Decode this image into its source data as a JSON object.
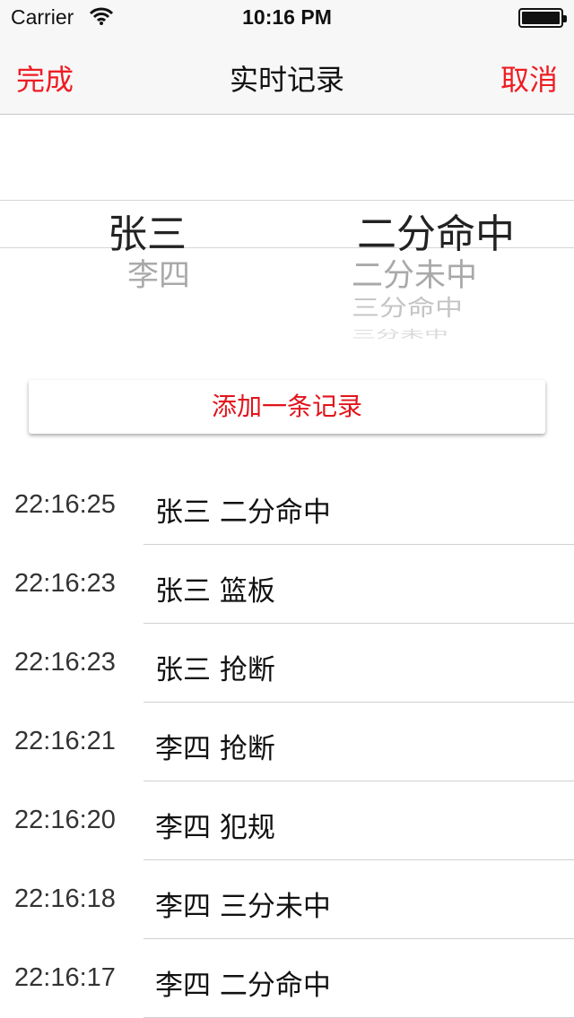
{
  "status_bar": {
    "carrier": "Carrier",
    "time": "10:16 PM"
  },
  "nav": {
    "left_label": "完成",
    "title": "实时记录",
    "right_label": "取消"
  },
  "picker": {
    "players": [
      "张三",
      "李四"
    ],
    "selected_player": "张三",
    "actions": [
      "二分命中",
      "二分未中",
      "三分命中",
      "三分未中"
    ],
    "selected_action": "二分命中"
  },
  "add_button": {
    "label": "添加一条记录"
  },
  "records": [
    {
      "time": "22:16:25",
      "text": "张三 二分命中"
    },
    {
      "time": "22:16:23",
      "text": "张三 篮板"
    },
    {
      "time": "22:16:23",
      "text": "张三 抢断"
    },
    {
      "time": "22:16:21",
      "text": "李四 抢断"
    },
    {
      "time": "22:16:20",
      "text": "李四 犯规"
    },
    {
      "time": "22:16:18",
      "text": "李四 三分未中"
    },
    {
      "time": "22:16:17",
      "text": "李四 二分命中"
    }
  ],
  "colors": {
    "accent": "#ee1d23",
    "divider": "#d0d0d0",
    "bar_background": "#f7f7f7"
  }
}
